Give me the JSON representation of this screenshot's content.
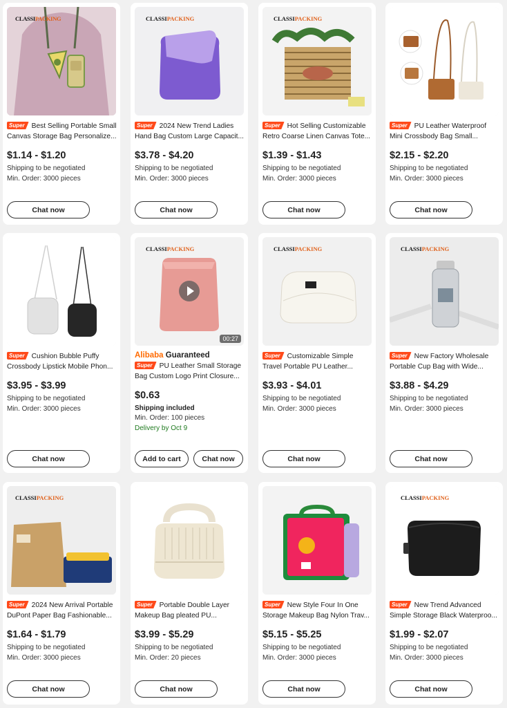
{
  "brand_logo": {
    "part1": "CLASSI",
    "part2": "PACKING"
  },
  "badge_label": "Super",
  "buttons": {
    "chat": "Chat now",
    "cart": "Add to cart"
  },
  "products": [
    {
      "title": "Best Selling Portable Small Canvas Storage Bag Personalize...",
      "price": "$1.14 - $1.20",
      "shipping": "Shipping to be negotiated",
      "moq": "Min. Order: 3000 pieces"
    },
    {
      "title": "2024 New Trend Ladies Hand Bag Custom Large Capacit...",
      "price": "$3.78 - $4.20",
      "shipping": "Shipping to be negotiated",
      "moq": "Min. Order: 3000 pieces"
    },
    {
      "title": "Hot Selling Customizable Retro Coarse Linen Canvas Tote...",
      "price": "$1.39 - $1.43",
      "shipping": "Shipping to be negotiated",
      "moq": "Min. Order: 3000 pieces"
    },
    {
      "title": "PU Leather Waterproof Mini Crossbody Bag Small...",
      "price": "$2.15 - $2.20",
      "shipping": "Shipping to be negotiated",
      "moq": "Min. Order: 3000 pieces"
    },
    {
      "title": "Cushion Bubble Puffy Crossbody Lipstick Mobile Phon...",
      "price": "$3.95 - $3.99",
      "shipping": "Shipping to be negotiated",
      "moq": "Min. Order: 3000 pieces"
    },
    {
      "title": "PU Leather Small Storage Bag Custom Logo Print Closure...",
      "price": "$0.63",
      "shipping": "Shipping included",
      "moq": "Min. Order: 100 pieces",
      "delivery": "Delivery by Oct 9",
      "guaranteed": {
        "alibaba": "Alibaba",
        "word": "Guaranteed"
      },
      "video_time": "00:27"
    },
    {
      "title": "Customizable Simple Travel Portable PU Leather...",
      "price": "$3.93 - $4.01",
      "shipping": "Shipping to be negotiated",
      "moq": "Min. Order: 3000 pieces"
    },
    {
      "title": "New Factory Wholesale Portable Cup Bag with Wide...",
      "price": "$3.88 - $4.29",
      "shipping": "Shipping to be negotiated",
      "moq": "Min. Order: 3000 pieces"
    },
    {
      "title": "2024 New Arrival Portable DuPont Paper Bag Fashionable...",
      "price": "$1.64 - $1.79",
      "shipping": "Shipping to be negotiated",
      "moq": "Min. Order: 3000 pieces"
    },
    {
      "title": "Portable Double Layer Makeup Bag pleated PU...",
      "price": "$3.99 - $5.29",
      "shipping": "Shipping to be negotiated",
      "moq": "Min. Order: 20 pieces"
    },
    {
      "title": "New Style Four In One Storage Makeup Bag Nylon Trav...",
      "price": "$5.15 - $5.25",
      "shipping": "Shipping to be negotiated",
      "moq": "Min. Order: 3000 pieces"
    },
    {
      "title": "New Trend Advanced Simple Storage Black Waterproo...",
      "price": "$1.99 - $2.07",
      "shipping": "Shipping to be negotiated",
      "moq": "Min. Order: 3000 pieces"
    }
  ],
  "colors": {
    "accent": "#ff6a00",
    "badge": "#ff4a1a",
    "delivery": "#1f7a1f",
    "background": "#f1f1f1"
  }
}
